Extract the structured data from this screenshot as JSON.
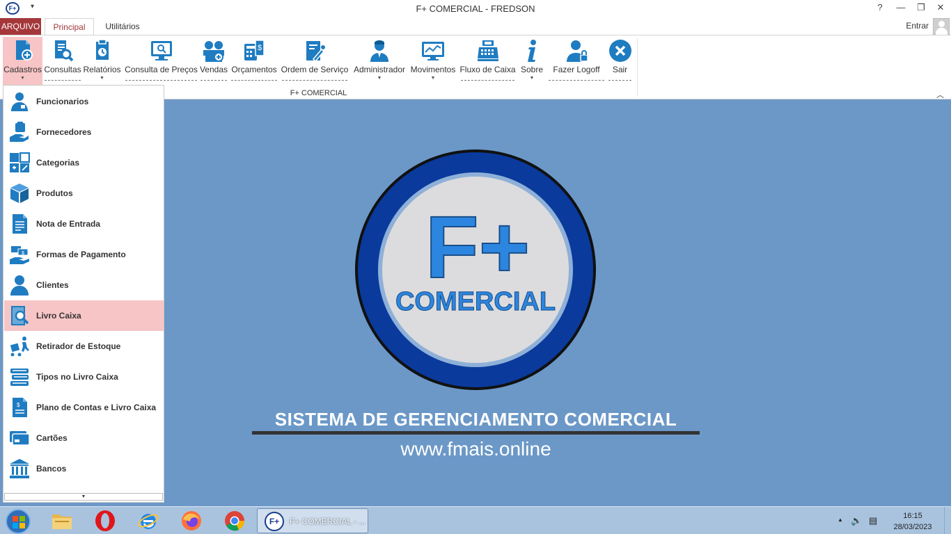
{
  "window": {
    "title": "F+ COMERCIAL - FREDSON",
    "help": "?",
    "app_icon_text": "F+"
  },
  "ribbon": {
    "file_tab": "ARQUIVO",
    "tabs": [
      {
        "label": "Principal",
        "active": true
      },
      {
        "label": "Utilitários",
        "active": false
      }
    ],
    "enter_label": "Entrar",
    "group_label": "F+ COMERCIAL",
    "buttons": [
      {
        "label": "Cadastros",
        "icon": "register-icon"
      },
      {
        "label": "Consultas",
        "icon": "query-icon"
      },
      {
        "label": "Relatórios",
        "icon": "report-icon"
      },
      {
        "label": "Consulta de Preços",
        "icon": "price-monitor-icon"
      },
      {
        "label": "Vendas",
        "icon": "sales-icon"
      },
      {
        "label": "Orçamentos",
        "icon": "calculator-icon"
      },
      {
        "label": "Ordem de Serviço",
        "icon": "service-order-icon"
      },
      {
        "label": "Administrador",
        "icon": "admin-icon"
      },
      {
        "label": "Movimentos",
        "icon": "movement-chart-icon"
      },
      {
        "label": "Fluxo de Caixa",
        "icon": "cash-register-icon"
      },
      {
        "label": "Sobre",
        "icon": "info-icon"
      },
      {
        "label": "Fazer Logoff",
        "icon": "logoff-icon"
      },
      {
        "label": "Sair",
        "icon": "exit-icon"
      }
    ]
  },
  "menu": {
    "items": [
      {
        "label": "Funcionarios",
        "icon": "employee-icon"
      },
      {
        "label": "Fornecedores",
        "icon": "supplier-icon"
      },
      {
        "label": "Categorias",
        "icon": "categories-icon"
      },
      {
        "label": "Produtos",
        "icon": "product-box-icon"
      },
      {
        "label": "Nota de Entrada",
        "icon": "invoice-icon"
      },
      {
        "label": "Formas de Pagamento",
        "icon": "payment-icon"
      },
      {
        "label": "Clientes",
        "icon": "client-icon"
      },
      {
        "label": "Livro Caixa",
        "icon": "cash-book-icon"
      },
      {
        "label": "Retirador de Estoque",
        "icon": "stock-withdraw-icon"
      },
      {
        "label": "Tipos no Livro Caixa",
        "icon": "books-stack-icon"
      },
      {
        "label": "Plano de Contas e Livro Caixa",
        "icon": "accounts-plan-icon"
      },
      {
        "label": "Cartões",
        "icon": "card-icon"
      },
      {
        "label": "Bancos",
        "icon": "bank-icon"
      }
    ],
    "active_item": "Livro Caixa"
  },
  "logo": {
    "line1": "F+",
    "line2": "COMERCIAL"
  },
  "slogan": "SISTEMA DE GERENCIAMENTO COMERCIAL",
  "website": "www.fmais.online",
  "taskbar": {
    "task_label": "F+ COMERCIAL - ...",
    "task_icon_text": "F+",
    "time": "16:15",
    "date": "28/03/2023"
  },
  "colors": {
    "accent_red": "#a4373a",
    "icon_blue": "#1f7cc1",
    "desktop_bg": "#6b98c7",
    "logo_dark_blue": "#0a3a9c",
    "logo_light_blue": "#2c86df"
  }
}
